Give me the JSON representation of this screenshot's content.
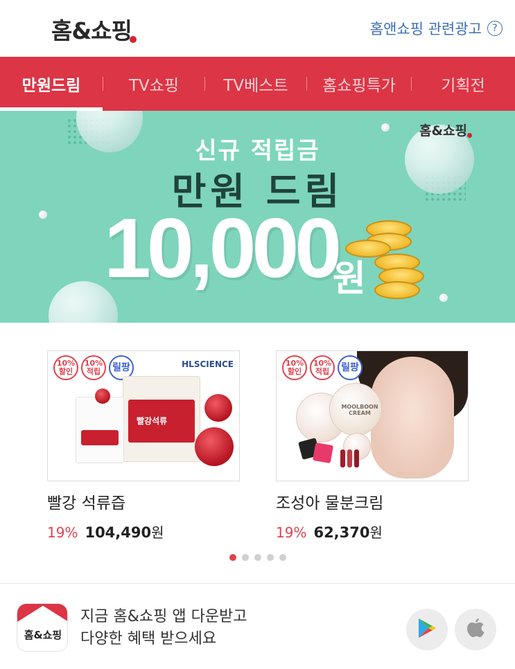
{
  "header": {
    "logo_text": "홈&쇼핑",
    "ad_link": "홈앤쇼핑 관련광고",
    "help_symbol": "?"
  },
  "nav": {
    "items": [
      {
        "label": "만원드림",
        "active": true
      },
      {
        "label": "TV쇼핑",
        "active": false
      },
      {
        "label": "TV베스트",
        "active": false
      },
      {
        "label": "홈쇼핑특가",
        "active": false
      },
      {
        "label": "기획전",
        "active": false
      }
    ]
  },
  "banner": {
    "logo_text": "홈&쇼핑",
    "line1": "신규 적립금",
    "line2": "만원 드림",
    "amount": "10,000",
    "currency": "원",
    "background": "#7ed5bc"
  },
  "products": [
    {
      "name": "빨강 석류즙",
      "discount": "19%",
      "price": "104,490",
      "unit": "원",
      "badges": {
        "discount": "10%",
        "discount_sub": "할인",
        "points": "10%",
        "points_sub": "적립",
        "live": "릴팡"
      },
      "brand": "HLSCIENCE",
      "package_text": "빨강석류"
    },
    {
      "name": "조성아 물분크림",
      "discount": "19%",
      "price": "62,370",
      "unit": "원",
      "badges": {
        "discount": "10%",
        "discount_sub": "할인",
        "points": "10%",
        "points_sub": "적립",
        "live": "릴팡"
      },
      "package_text": "MOOLBOON CREAM"
    }
  ],
  "pager": {
    "total": 5,
    "current": 1
  },
  "footer": {
    "app_icon_text": "홈&쇼핑",
    "message_line1": "지금 홈&쇼핑 앱 다운받고",
    "message_line2": "다양한 혜택 받으세요",
    "stores": [
      "google-play-icon",
      "apple-icon"
    ]
  },
  "colors": {
    "accent": "#dc3545",
    "price_discount": "#e0424d",
    "link": "#3d6fb6"
  }
}
